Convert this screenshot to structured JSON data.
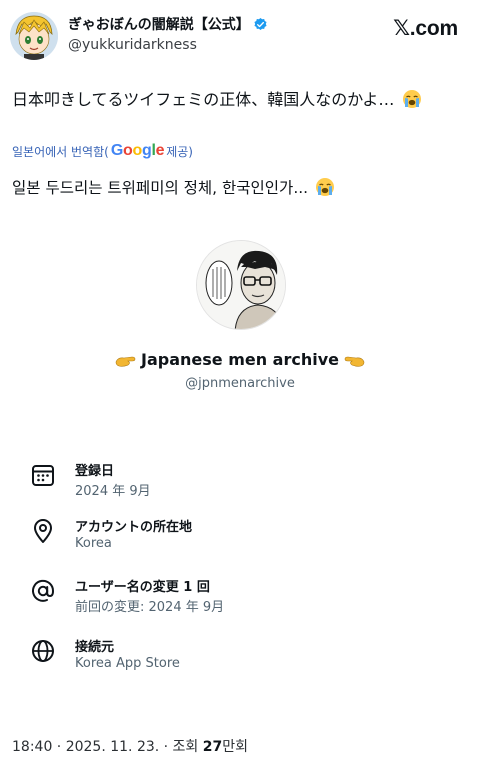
{
  "header": {
    "author_name": "ぎゃおぼんの闇解説【公式】",
    "handle": "@yukkuridarkness",
    "brand": "𝕏.com",
    "avatar_icon": "anime-character-avatar-icon",
    "verified_icon": "verified-badge-icon"
  },
  "tweet": {
    "text": "日本叩きしてるツイフェミの正体、韓国人なのかよ…",
    "emoji": "loudly-crying-face-icon"
  },
  "translation": {
    "prefix": "일본어에서 번역함(",
    "google_letters": [
      "G",
      "o",
      "o",
      "g",
      "l",
      "e"
    ],
    "suffix": " 제공)",
    "text": "일본 두드리는 트위페미의 정체, 한국인인가... "
  },
  "profile": {
    "name": "Japanese men archive",
    "handle": "@jpnmenarchive",
    "hand_icon": "pinching-hand-icon",
    "picture": "manga-man-with-glasses-avatar-icon"
  },
  "info": [
    {
      "icon": "calendar-icon",
      "title": "登録日",
      "sub": "2024 年 9月"
    },
    {
      "icon": "location-pin-icon",
      "title": "アカウントの所在地",
      "sub": "Korea"
    },
    {
      "icon": "at-sign-icon",
      "title": "ユーザー名の変更 1 回",
      "sub": "前回の変更: 2024 年 9月"
    },
    {
      "icon": "globe-icon",
      "title": "接続元",
      "sub": "Korea App Store"
    }
  ],
  "footer": {
    "meta": "18:40 · 2025. 11. 23. · 조회 ",
    "views": "27",
    "views_unit": "만회"
  },
  "colors": {
    "link_blue": "#3763b6",
    "google_blue": "#4285f4",
    "google_red": "#ea4335",
    "google_yellow": "#fbbc05",
    "google_green": "#34a853",
    "verified_blue": "#1d9bf0",
    "secondary_text": "#536471"
  }
}
